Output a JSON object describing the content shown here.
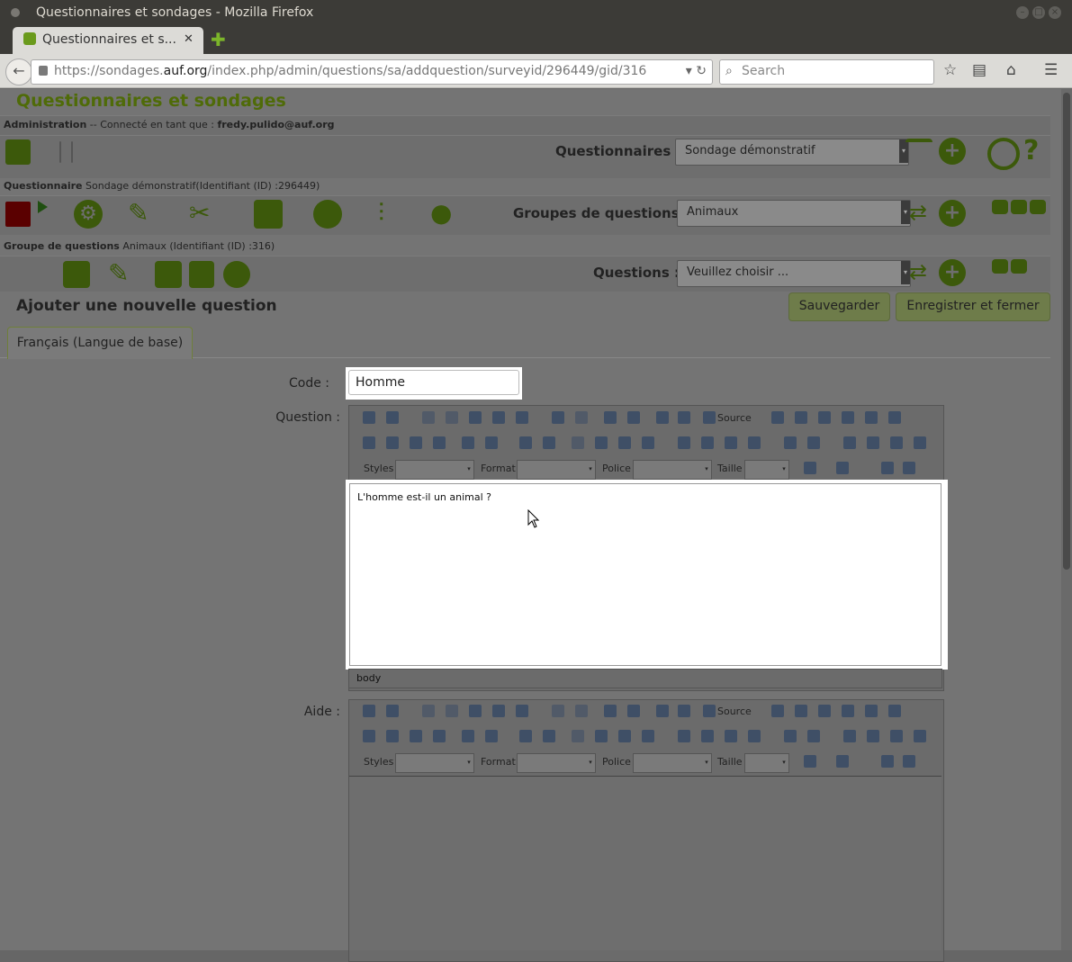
{
  "window": {
    "title": "Questionnaires et sondages - Mozilla Firefox"
  },
  "tab": {
    "label": "Questionnaires et s...",
    "close": "✕"
  },
  "url": {
    "prefix": "https://sondages.",
    "domain": "auf.org",
    "path": "/index.php/admin/questions/sa/addquestion/surveyid/296449/gid/316"
  },
  "search": {
    "placeholder": "Search"
  },
  "header": {
    "title": "Questionnaires et sondages"
  },
  "admin": {
    "label": "Administration",
    "connected": " -- Connecté en tant que : ",
    "user": "fredy.pulido@auf.org"
  },
  "surveys": {
    "label": "Questionnaires :",
    "selected": "Sondage démonstratif"
  },
  "survey": {
    "label": "Questionnaire",
    "name": " Sondage démonstratif(Identifiant (ID) :296449)"
  },
  "groups": {
    "label": "Groupes de questions :",
    "selected": "Animaux"
  },
  "group": {
    "label": "Groupe de questions",
    "name": "  Animaux (Identifiant (ID) :316)"
  },
  "questions": {
    "label": "Questions :",
    "selected": "Veuillez choisir ..."
  },
  "form": {
    "heading": "Ajouter une nouvelle question",
    "save": "Sauvegarder",
    "save_close": "Enregistrer et fermer",
    "lang_tab": "Français (Langue de base)",
    "code_label": "Code :",
    "code_value": "Homme",
    "question_label": "Question :",
    "question_text": "L'homme est-il un animal ?",
    "help_label": "Aide :",
    "path": "body"
  },
  "editor": {
    "source": "Source",
    "styles": "Styles",
    "format": "Format",
    "police": "Police",
    "taille": "Taille"
  },
  "colors": {
    "accent": "#6a9a1c",
    "title": "#4f6b08",
    "overlay": "#747474"
  },
  "icons": [
    "home-icon",
    "gear-icon",
    "pencil-icon",
    "tools-icon",
    "export-icon",
    "run-icon",
    "tree-icon",
    "users-icon",
    "list-icon",
    "plus-icon",
    "power-icon",
    "help-icon"
  ]
}
